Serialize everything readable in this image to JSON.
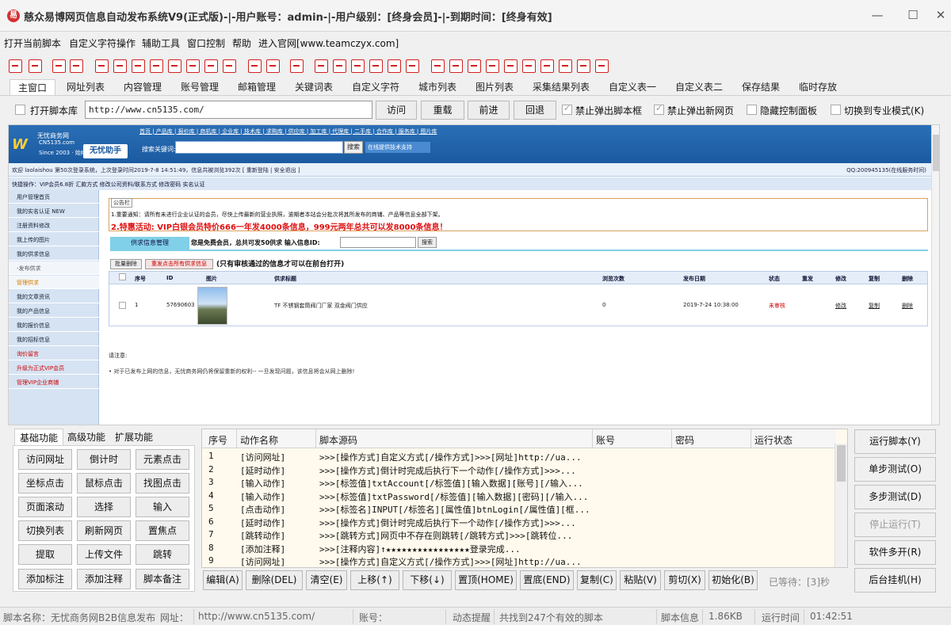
{
  "window": {
    "title": "慈众易博网页信息自动发布系统V9(正式版)-|-用户账号：admin-|-用户级别：[终身会员]-|-到期时间：[终身有效]",
    "app_icon_glyph": "易",
    "minimize": "—",
    "maximize": "☐",
    "close": "✕"
  },
  "menubar": [
    "打开当前脚本",
    "自定义字符操作",
    "辅助工具",
    "窗口控制",
    "帮助",
    "进入官网[www.teamczyx.com]"
  ],
  "tabs": [
    "主窗口",
    "网址列表",
    "内容管理",
    "账号管理",
    "邮箱管理",
    "关键词表",
    "自定义字符",
    "城市列表",
    "图片列表",
    "采集结果列表",
    "自定义表一",
    "自定义表二",
    "保存结果",
    "临时存放"
  ],
  "address": {
    "open_lib_label": "打开脚本库",
    "url": "http://www.cn5135.com/",
    "visit": "访问",
    "reload": "重载",
    "forward": "前进",
    "back": "回退",
    "block_script_popup": "禁止弹出脚本框",
    "block_new_page": "禁止弹出新网页",
    "hide_panel": "隐藏控制面板",
    "pro_mode": "切换到专业模式(K)"
  },
  "webpage": {
    "logo_mark": "W",
    "logo_name": "无忧商务网",
    "logo_site": "CN5135.com",
    "logo_since": "Since 2003 · 始终于2009年",
    "assistant": "无忧助手",
    "nav": "首页 | 产品库 | 报价库 | 商机库 | 企业库 | 技术库 | 求购库 | 供应库 | 加工库 | 代理库 | 二手库 | 合作库 | 服务库 | 图片库",
    "search_label": "搜索关键词:",
    "search_btn": "搜索",
    "support": "在线提供技术支持",
    "welcome": "欢迎 laolaishou 第50次登录系统，上次登录时间2019-7-8 14:51:49，信息共被浏览392次 [ 重新登陆 | 安全退出 ]",
    "qq": "QQ:200945135(在线服务时间)",
    "quick": "快捷操作：VIP会员6.8折 汇款方式 修改公司资料/联系方式 修改密码 实名认证",
    "side": [
      "用户管理首页",
      "我的实名认证 NEW",
      "注册资料修改",
      "我上传的图片",
      "我的供求信息",
      "-发布供求",
      "管理供求",
      "我的文章资讯",
      "我的产品信息",
      "我的报价信息",
      "我的招标信息",
      "询价留言",
      "升级为正式VIP会员",
      "管理VIP企业商铺"
    ],
    "notice_title": "公告栏",
    "notice_line1": "1.重要通知：请所有未进行企业认证的会员，尽快上传最新的营业执照，逾期者本站会分批次将其所发布的商铺、产品等信息全部下架。",
    "notice_line2": "2.特惠活动: VIP白银会员特价666一年发4000条信息，999元两年总共可以发8000条信息！",
    "supply_tab": "供求信息管理",
    "free_text": "您是免费会员，总共可发50供求  输入信息ID:",
    "supply_search": "搜索",
    "bulk_delete": "批量删除",
    "resubmit": "重发点击所有供求信息",
    "only_text": "(只有审核通过的信息才可以在前台打开)",
    "table_headers": [
      "序号",
      "ID",
      "图片",
      "供求标题",
      "浏览次数",
      "发布日期",
      "状态",
      "重发",
      "修改",
      "复制",
      "删除"
    ],
    "row": {
      "no": "1",
      "id": "57690603",
      "title": "TF 不锈钢套筒阀门厂家 双金阀门供应",
      "views": "0",
      "date": "2019-7-24 10:38:00",
      "status": "未审核",
      "edit": "修改",
      "copy": "复制",
      "delete": "删除"
    },
    "note_title": "请注意:",
    "note_body": "• 对于已发布上网的信息，无忧商务网仍将保留重新的权利-- 一旦发现问题，该信息将会从网上删除!"
  },
  "functions": {
    "tabs": [
      "基础功能",
      "高级功能",
      "扩展功能"
    ],
    "buttons": [
      "访问网址",
      "倒计时",
      "元素点击",
      "坐标点击",
      "鼠标点击",
      "找图点击",
      "页面滚动",
      "选择",
      "输入",
      "切换列表",
      "刷新网页",
      "置焦点",
      "提取",
      "上传文件",
      "跳转",
      "添加标注",
      "添加注释",
      "脚本备注"
    ]
  },
  "log": {
    "headers": [
      "序号",
      "动作名称",
      "脚本源码",
      "账号",
      "密码",
      "运行状态"
    ],
    "rows": [
      [
        "1",
        "[访问网址]",
        ">>>[操作方式]自定义方式[/操作方式]>>>[网址]http://ua..."
      ],
      [
        "2",
        "[延时动作]",
        ">>>[操作方式]倒计时完成后执行下一个动作[/操作方式]>>>..."
      ],
      [
        "3",
        "[输入动作]",
        ">>>[标签值]txtAccount[/标签值][输入数据][账号][/输入..."
      ],
      [
        "4",
        "[输入动作]",
        ">>>[标签值]txtPassword[/标签值][输入数据][密码][/输入..."
      ],
      [
        "5",
        "[点击动作]",
        ">>>[标签名]INPUT[/标签名][属性值]btnLogin[/属性值][框..."
      ],
      [
        "6",
        "[延时动作]",
        ">>>[操作方式]倒计时完成后执行下一个动作[/操作方式]>>>..."
      ],
      [
        "7",
        "[跳转动作]",
        ">>>[跳转方式]网页中不存在则跳转[/跳转方式]>>>[跳转位..."
      ],
      [
        "8",
        "[添加注释]",
        ">>>[注释内容]↑★★★★★★★★★★★★★★★★登录完成..."
      ],
      [
        "9",
        "[访问网址]",
        ">>>[操作方式]自定义方式[/操作方式]>>>[网址]http://ua..."
      ]
    ]
  },
  "edit_buttons": [
    "编辑(A)",
    "删除(DEL)",
    "清空(E)",
    "上移(↑)",
    "下移(↓)",
    "置顶(HOME)",
    "置底(END)",
    "复制(C)",
    "粘贴(V)",
    "剪切(X)",
    "初始化(B)"
  ],
  "wait_text": "已等待：[3]秒",
  "right_buttons": [
    "运行脚本(Y)",
    "单步测试(O)",
    "多步测试(D)",
    "停止运行(T)",
    "软件多开(R)",
    "后台挂机(H)"
  ],
  "status": {
    "script_name_label": "脚本名称：",
    "script_name": "无忧商务网B2B信息发布",
    "url_label": "网址：",
    "url": "http://www.cn5135.com/",
    "account_label": "账号：",
    "account": "",
    "dyn_label": "动态提醒",
    "dyn": "共找到247个有效的脚本",
    "info_label": "脚本信息",
    "info": "1.86KB",
    "time_label": "运行时间",
    "time": "01:42:51"
  },
  "colors": {
    "accent_red": "#d12020",
    "web_blue": "#1b5aa0",
    "log_bg": "#fffaed"
  }
}
